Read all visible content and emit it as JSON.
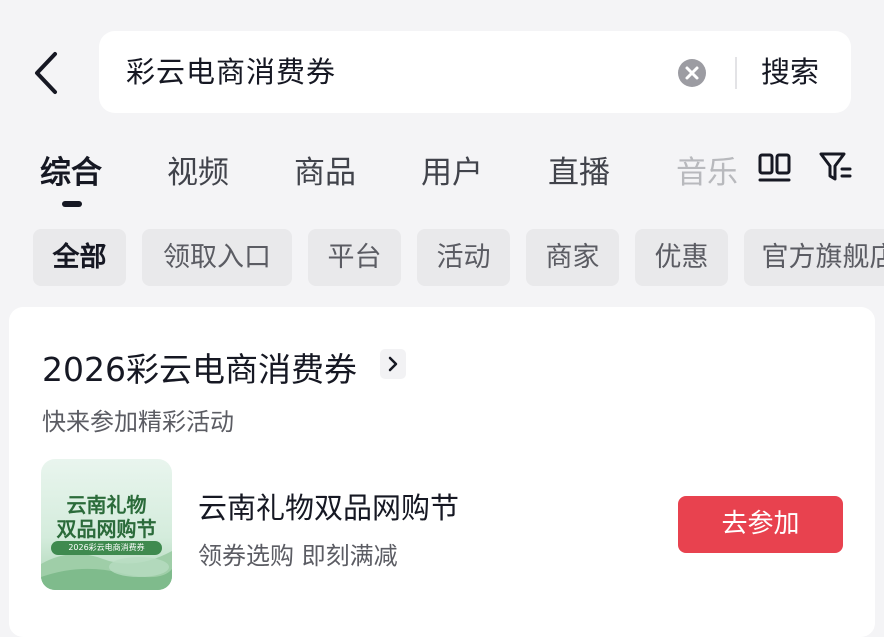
{
  "search": {
    "query": "彩云电商消费券",
    "search_label": "搜索"
  },
  "tabs": [
    {
      "label": "综合",
      "active": true
    },
    {
      "label": "视频"
    },
    {
      "label": "商品"
    },
    {
      "label": "用户"
    },
    {
      "label": "直播"
    },
    {
      "label": "音乐"
    }
  ],
  "tab_icons": {
    "layout": "dual-column-icon",
    "filter": "filter-icon"
  },
  "chips": [
    "全部",
    "领取入口",
    "平台",
    "活动",
    "商家",
    "优惠",
    "官方旗舰店"
  ],
  "card": {
    "title": "2026彩云电商消费券",
    "subtitle": "快来参加精彩活动",
    "item": {
      "thumb_line1": "云南礼物",
      "thumb_line2": "双品网购节",
      "thumb_line3": "2026彩云电商消费券",
      "title": "云南礼物双品网购节",
      "desc": "领券选购  即刻满减",
      "button": "去参加"
    }
  },
  "colors": {
    "background": "#f4f4f6",
    "accent": "#e8424f",
    "thumb_green": "#2b6b3a"
  }
}
